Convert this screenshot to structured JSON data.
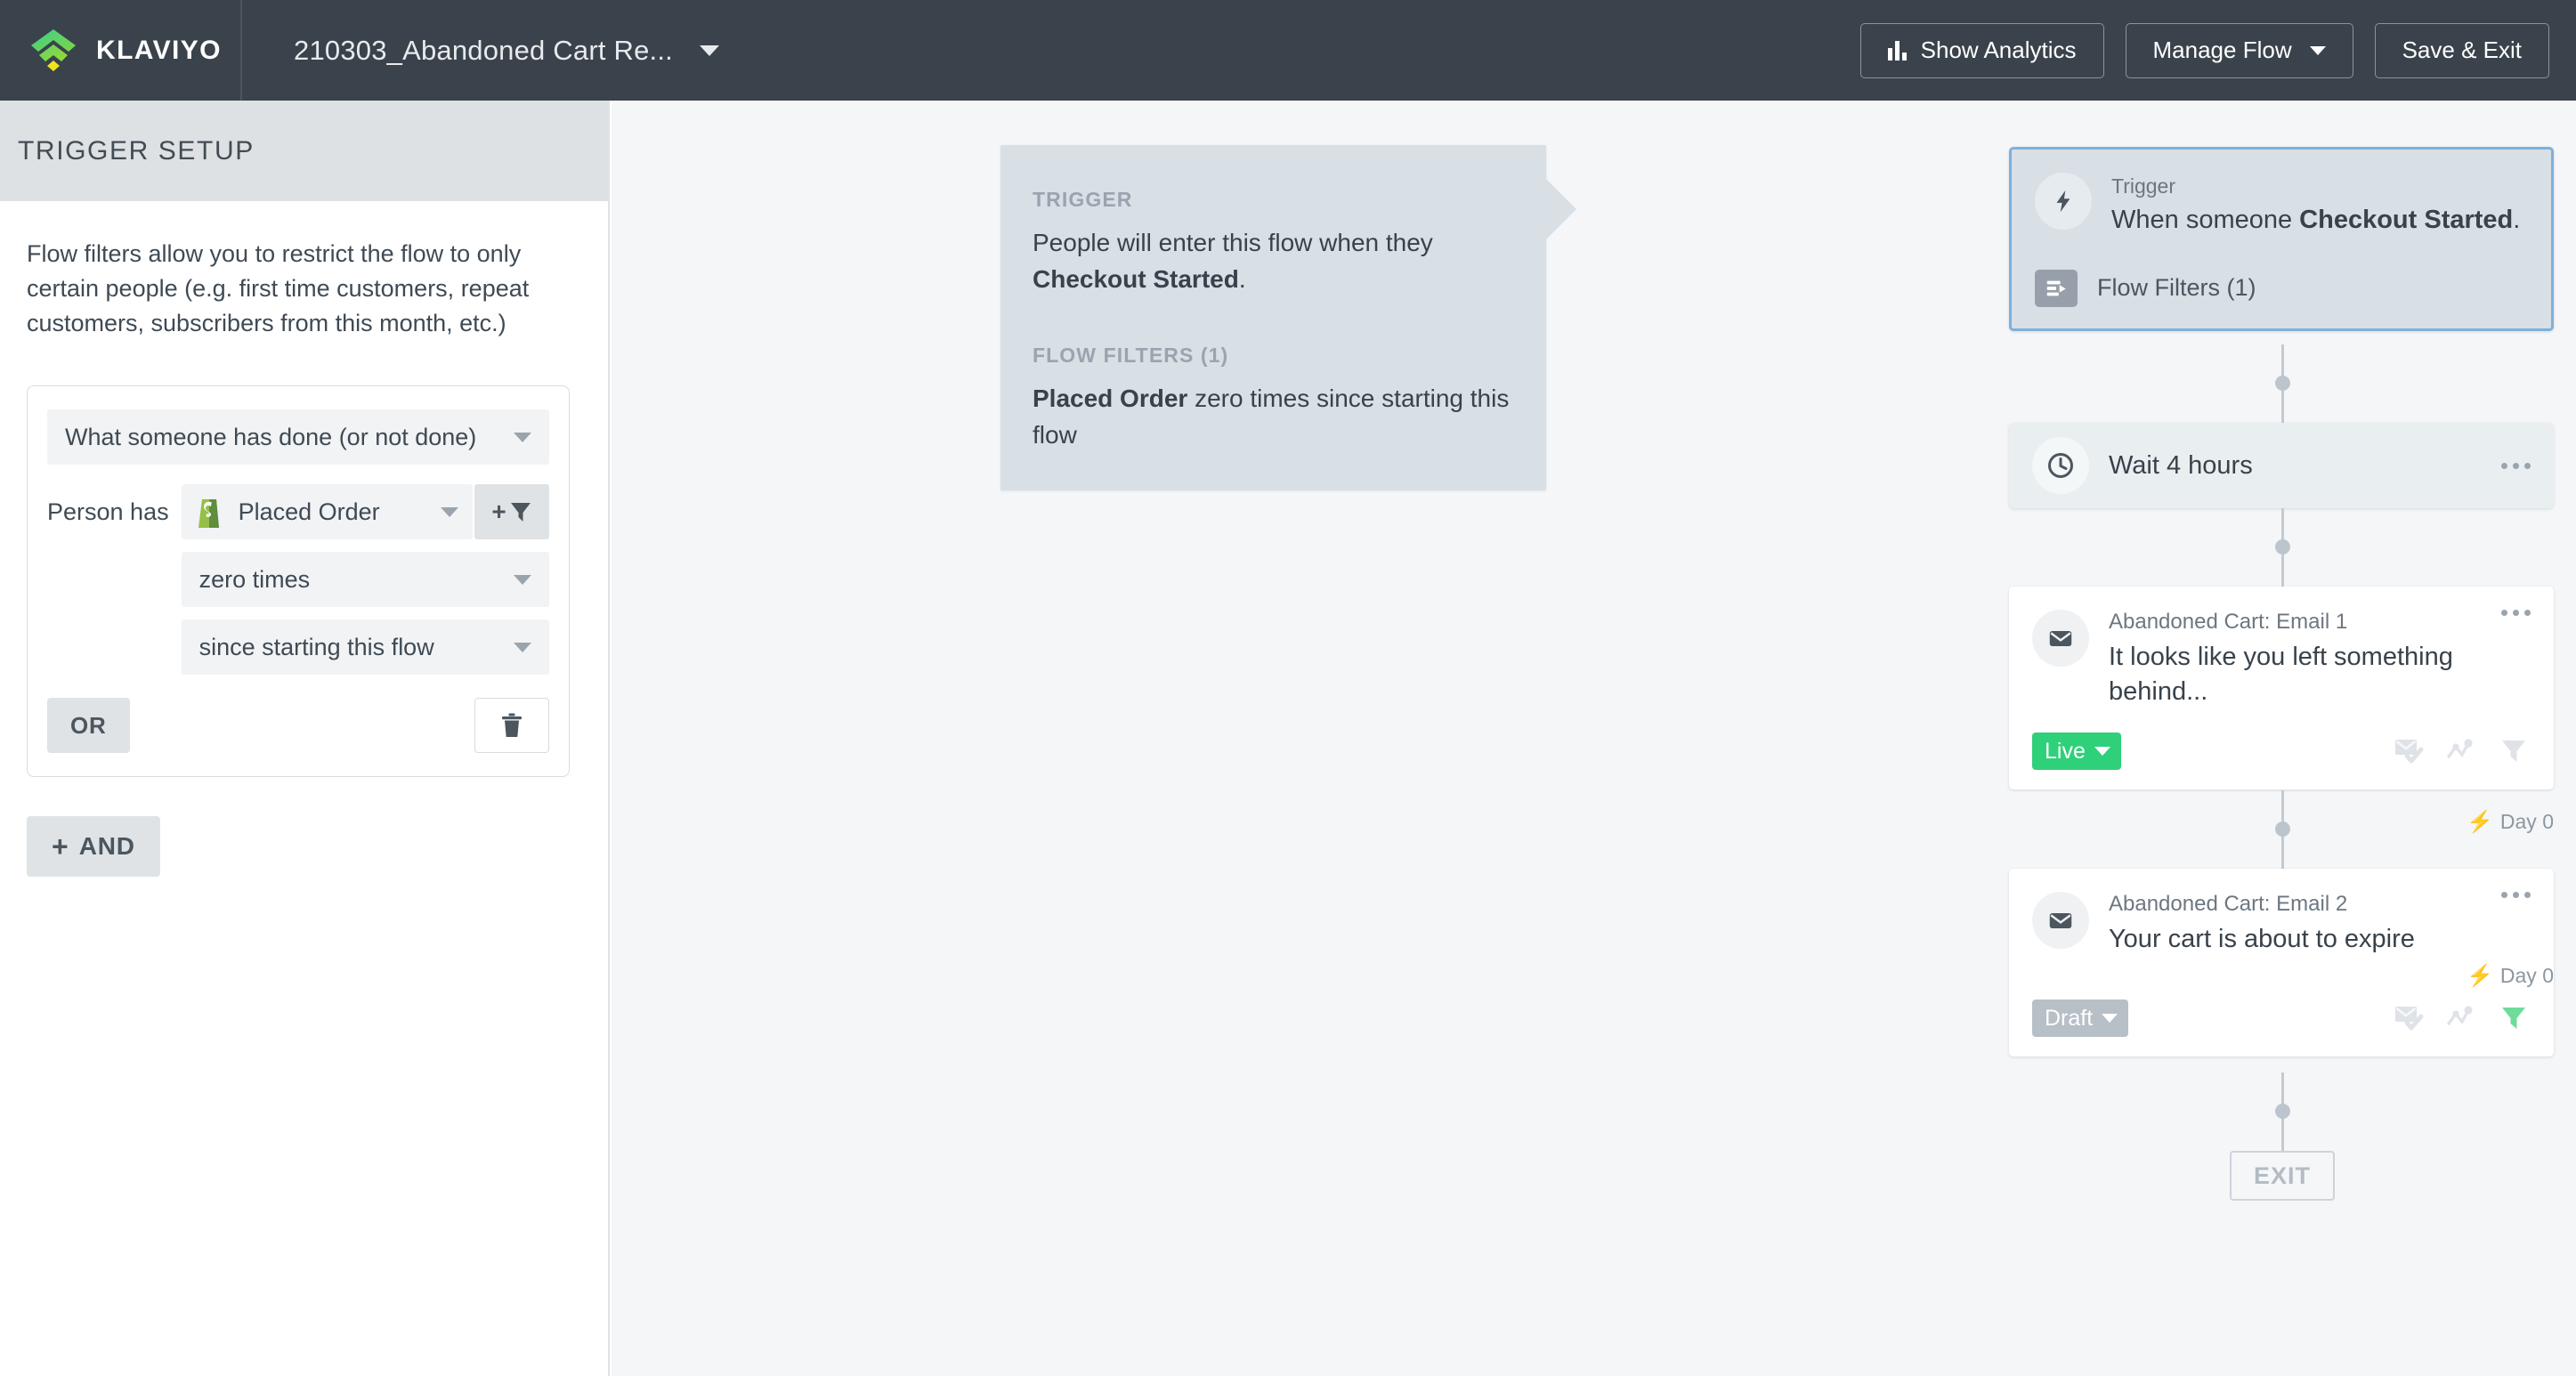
{
  "topbar": {
    "brand_name": "KLAVIYO",
    "brand_icon": "klaviyo-logo-icon",
    "flow_title": "210303_Abandoned Cart Re...",
    "flow_title_caret_icon": "chevron-down-icon",
    "buttons": [
      {
        "label": "Show Analytics",
        "icon": "bar-chart-icon",
        "has_caret": false
      },
      {
        "label": "Manage Flow",
        "icon": "",
        "has_caret": true
      },
      {
        "label": "Save & Exit",
        "icon": "",
        "has_caret": false
      }
    ]
  },
  "sidebar": {
    "header_title": "TRIGGER SETUP",
    "helper_text": "Flow filters allow you to restrict the flow to only certain people (e.g. first time customers, repeat customers, subscribers from this month, etc.)",
    "filter_card": {
      "condition_type": "What someone has done (or not done)",
      "person_has_label": "Person has",
      "metric": "Placed Order",
      "metric_icon": "shopify-icon",
      "add_filter_icon": "add-filter-funnel-icon",
      "frequency": "zero times",
      "timeframe": "since starting this flow",
      "or_label": "OR",
      "delete_icon": "trash-icon"
    },
    "and_button_label": "AND",
    "and_button_plus": "+"
  },
  "canvas": {
    "summary": {
      "trigger_kicker": "TRIGGER",
      "trigger_line_1": "People will enter this flow when they",
      "trigger_metric": "Checkout Started",
      "trigger_period": ".",
      "filters_kicker": "FLOW FILTERS (1)",
      "filter_metric": "Placed Order",
      "filter_rest": " zero times since starting this flow"
    },
    "nodes": [
      {
        "type": "trigger",
        "kicker": "Trigger",
        "title_prefix": "When someone ",
        "title_metric": "Checkout Started",
        "title_suffix": ".",
        "icon": "lightning-bolt-icon",
        "flow_filters_label": "Flow Filters (1)",
        "flow_filters_icon": "flow-filters-icon",
        "selected": true
      },
      {
        "type": "wait",
        "label": "Wait 4 hours",
        "icon": "clock-icon",
        "menu_icon": "more-options-icon"
      },
      {
        "type": "email",
        "name": "Abandoned Cart: Email 1",
        "subject": "It looks like you left something behind...",
        "icon": "envelope-icon",
        "menu_icon": "more-options-icon",
        "status": "Live",
        "status_color": "#2fd07a",
        "footer_icons": [
          {
            "name": "smart-sending-icon",
            "active": false
          },
          {
            "name": "conditional-split-icon",
            "active": false
          },
          {
            "name": "filter-icon",
            "active": false
          }
        ],
        "day_label": "Day 0"
      },
      {
        "type": "email",
        "name": "Abandoned Cart: Email 2",
        "subject": "Your cart is about to expire",
        "icon": "envelope-icon",
        "menu_icon": "more-options-icon",
        "status": "Draft",
        "status_color": "#b7bfc7",
        "footer_icons": [
          {
            "name": "smart-sending-icon",
            "active": false
          },
          {
            "name": "conditional-split-icon",
            "active": false
          },
          {
            "name": "filter-icon",
            "active": true
          }
        ],
        "day_label": "Day 0"
      }
    ],
    "exit_label": "EXIT",
    "bolt_glyph": "⚡"
  },
  "colors": {
    "topbar_bg": "#3a434c",
    "sidebar_header_bg": "#dee1e3",
    "canvas_bg": "#f5f6f8",
    "selected_border": "#7cb1dd",
    "trigger_node_bg": "#d8dfe5",
    "wait_node_bg": "#e9eff0",
    "live_green": "#2fd07a",
    "draft_gray": "#b7bfc7",
    "shopify_green": "#7ab55c",
    "connector_gray": "#c2cad2"
  }
}
